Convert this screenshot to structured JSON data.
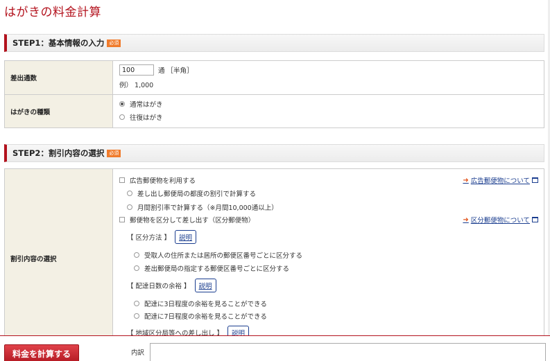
{
  "page_title": "はがきの料金計算",
  "required_badge": "必須",
  "step1": {
    "title": "STEP1：基本情報の入力",
    "quantity_label": "差出通数",
    "quantity_value": "100",
    "quantity_unit": "通 ［半角］",
    "quantity_example": "例） 1,000",
    "type_label": "はがきの種類",
    "type_options": [
      "通常はがき",
      "往復はがき"
    ],
    "type_selected": "通常はがき"
  },
  "step2": {
    "title": "STEP2：割引内容の選択",
    "discount_label": "割引内容の選択",
    "ad_mail_checkbox": "広告郵便物を利用する",
    "ad_mail_link": "広告郵便物について",
    "ad_options": [
      "差し出し郵便局の都度の割引で計算する",
      "月間割引率で計算する（※月間10,000通以上）"
    ],
    "sorted_checkbox": "郵便物を区分して差し出す（区分郵便物）",
    "sorted_link": "区分郵便物について",
    "sort_method_label": "【 区分方法 】",
    "sort_method_options": [
      "受取人の住所または居所の郵便区番号ごとに区分する",
      "差出郵便局の指定する郵便区番号ごとに区分する"
    ],
    "delivery_days_label": "【 配達日数の余裕 】",
    "delivery_days_options": [
      "配達に3日程度の余裕を見ることができる",
      "配達に7日程度の余裕を見ることができる"
    ],
    "regional_label": "【 地域区分局等への差し出し 】",
    "explain_button": "説明"
  },
  "bottom": {
    "calc_button": "料金を計算する",
    "detail_label": "内訳",
    "detail_value": ""
  }
}
